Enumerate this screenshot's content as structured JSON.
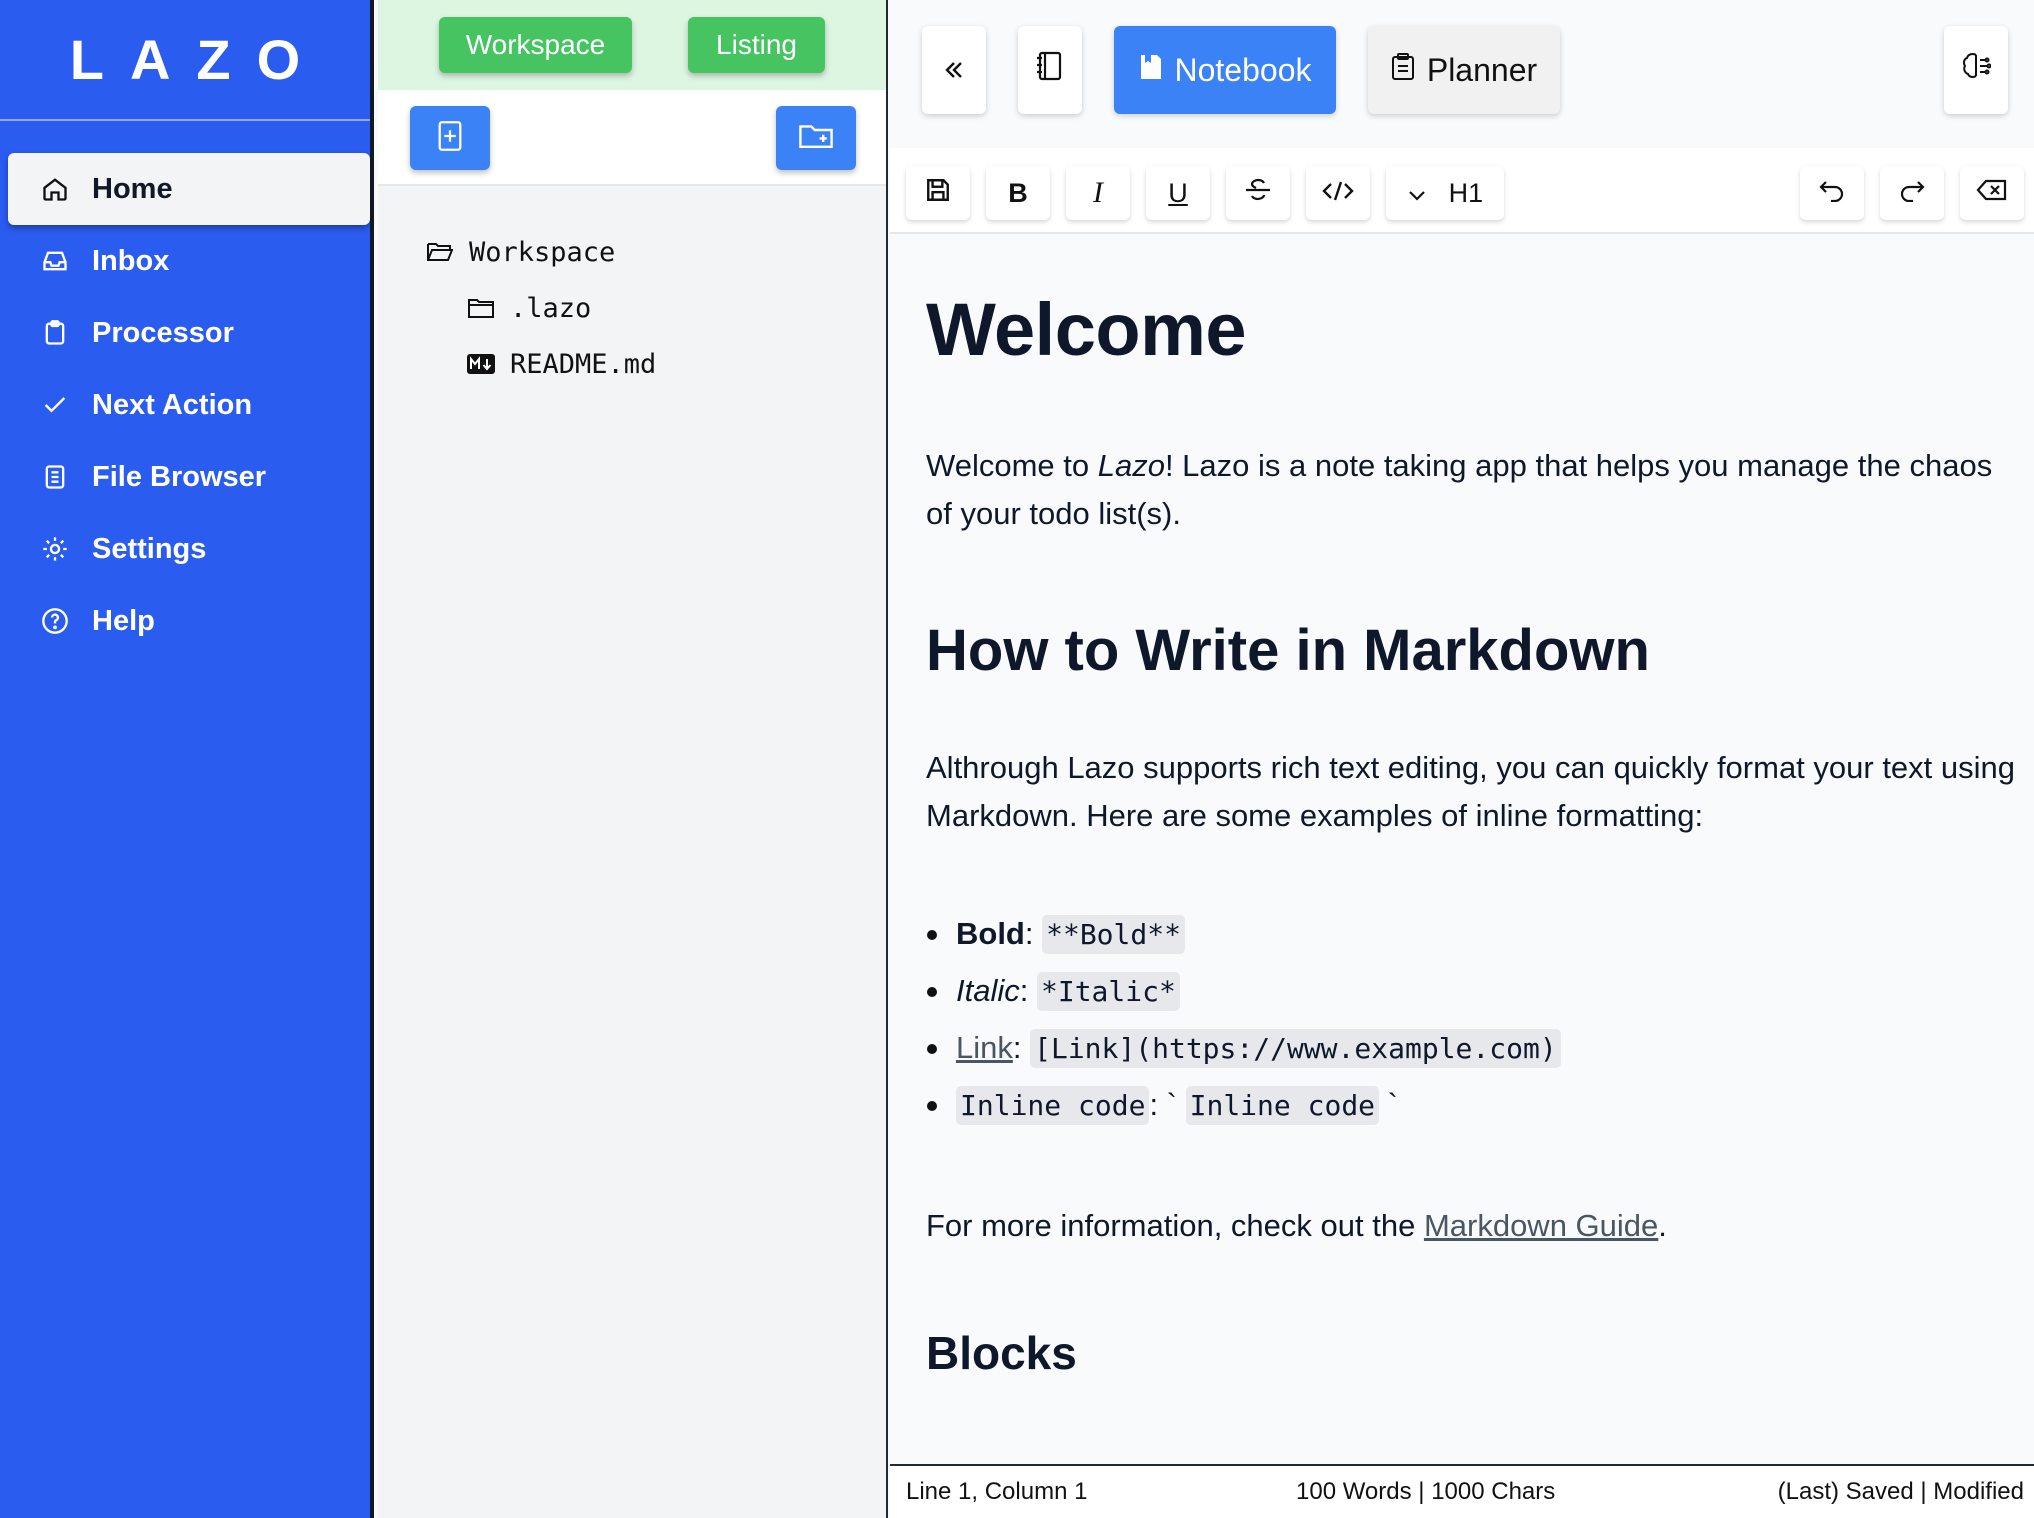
{
  "app": {
    "logo": "LAZO"
  },
  "sidebar": {
    "items": [
      {
        "label": "Home",
        "icon": "home-icon"
      },
      {
        "label": "Inbox",
        "icon": "inbox-icon"
      },
      {
        "label": "Processor",
        "icon": "clipboard-icon"
      },
      {
        "label": "Next Action",
        "icon": "check-icon"
      },
      {
        "label": "File Browser",
        "icon": "file-browser-icon"
      },
      {
        "label": "Settings",
        "icon": "gear-icon"
      },
      {
        "label": "Help",
        "icon": "help-icon"
      }
    ],
    "active": "Home"
  },
  "filepanel": {
    "tabs": {
      "workspace": "Workspace",
      "listing": "Listing"
    },
    "tree": {
      "root": "Workspace",
      "folder": ".lazo",
      "file": "README.md"
    }
  },
  "topbar": {
    "notebook": "Notebook",
    "planner": "Planner"
  },
  "format": {
    "heading": "H1",
    "bold": "B",
    "italic": "I",
    "underline": "U"
  },
  "doc": {
    "title": "Welcome",
    "intro_a": "Welcome to ",
    "intro_em": "Lazo",
    "intro_b": "! Lazo is a note taking app that helps you manage the chaos of your todo list(s).",
    "h2": "How to Write in Markdown",
    "p2": "Althrough Lazo supports rich text editing, you can quickly format your text using Markdown. Here are some examples of inline formatting:",
    "bullets": {
      "bold_label": "Bold",
      "bold_code": "**Bold**",
      "italic_label": "Italic",
      "italic_code": "*Italic*",
      "link_label": "Link",
      "link_code": "[Link](https://www.example.com)",
      "inline_label": "Inline code",
      "inline_code": "Inline code"
    },
    "more_a": "For more information, check out the ",
    "more_link": "Markdown Guide",
    "more_b": ".",
    "h3": "Blocks"
  },
  "status": {
    "position": "Line 1, Column 1",
    "counts": "100 Words | 1000 Chars",
    "save": "(Last) Saved | Modified"
  },
  "colors": {
    "sidebar": "#2b5cf0",
    "accent": "#3b82f6",
    "green": "#46c462",
    "green_bg": "#dcf6e1"
  }
}
